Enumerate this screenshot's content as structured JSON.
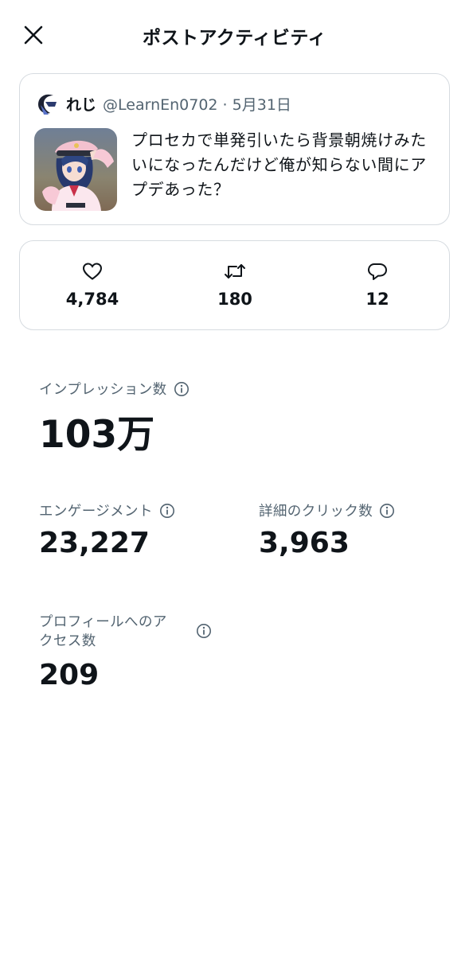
{
  "header": {
    "title": "ポストアクティビティ",
    "close_icon": "close-icon"
  },
  "tweet": {
    "author_name": "れじ",
    "author_meta": "@LearnEn0702 · 5月31日",
    "text": "プロセカで単発引いたら背景朝焼けみたいになったんだけど俺が知らない間にアプデあった？"
  },
  "stats": {
    "likes": "4,784",
    "reposts": "180",
    "replies": "12"
  },
  "metrics": {
    "impressions_label": "インプレッション数",
    "impressions_value": "103万",
    "engagement_label": "エンゲージメント",
    "engagement_value": "23,227",
    "detail_clicks_label": "詳細のクリック数",
    "detail_clicks_value": "3,963",
    "profile_visits_label_line1": "プロフィールへのア",
    "profile_visits_label_line2": "クセス数",
    "profile_visits_label_full": "プロフィールへのアクセス数",
    "profile_visits_value": "209"
  },
  "colors": {
    "text_primary": "#0f1419",
    "text_secondary": "#536471",
    "border": "#d6dbe0"
  }
}
